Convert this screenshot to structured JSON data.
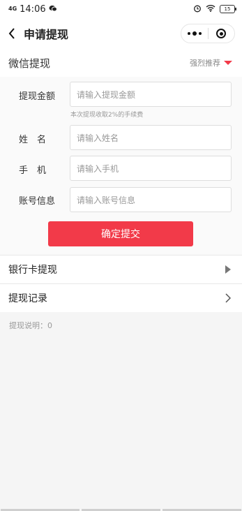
{
  "statusbar": {
    "signal": "4G",
    "time": "14:06",
    "battery": "15"
  },
  "nav": {
    "title": "申请提现"
  },
  "section": {
    "title": "微信提现",
    "recommend": "强烈推荐"
  },
  "form": {
    "amount_label": "提现金额",
    "amount_placeholder": "请输入提现金额",
    "fee_note": "本次提现收取2%的手续费",
    "name_label": "姓　名",
    "name_placeholder": "请输入姓名",
    "phone_label": "手　机",
    "phone_placeholder": "请输入手机",
    "account_label": "账号信息",
    "account_placeholder": "请输入账号信息",
    "submit_label": "确定提交"
  },
  "menu": {
    "bank_label": "银行卡提现",
    "records_label": "提现记录"
  },
  "note": {
    "text": "提现说明：0"
  },
  "colors": {
    "accent": "#f23a49",
    "background": "#f5f5f5"
  },
  "icons": [
    "back-arrow-icon",
    "more-dots-icon",
    "close-ring-icon",
    "red-triangle-icon",
    "triangle-right-icon",
    "chevron-right-icon"
  ]
}
